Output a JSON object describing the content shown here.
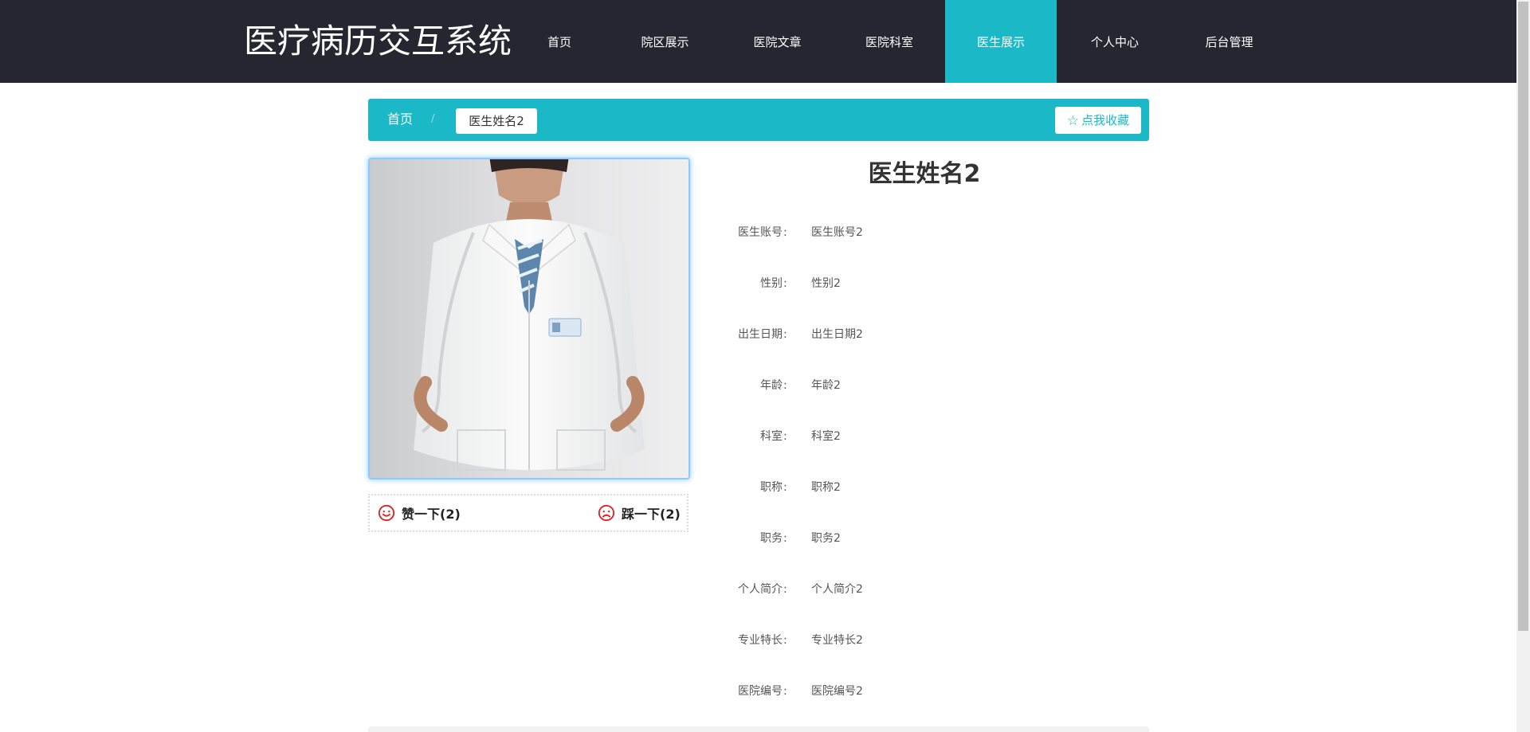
{
  "app": {
    "title": "医疗病历交互系统"
  },
  "nav": {
    "items": [
      {
        "label": "首页"
      },
      {
        "label": "院区展示"
      },
      {
        "label": "医院文章"
      },
      {
        "label": "医院科室"
      },
      {
        "label": "医生展示",
        "active": true
      },
      {
        "label": "个人中心"
      },
      {
        "label": "后台管理"
      }
    ]
  },
  "breadcrumb": {
    "home": "首页",
    "separator": "/",
    "current": "医生姓名2"
  },
  "favorite": {
    "icon": "star-outline-icon",
    "label": "点我收藏"
  },
  "doctor": {
    "name": "医生姓名2",
    "photo_icon": "doctor-photo",
    "fields": [
      {
        "label": "医生账号",
        "colon": ":",
        "value": "医生账号2"
      },
      {
        "label": "性别",
        "colon": ":",
        "value": "性别2"
      },
      {
        "label": "出生日期",
        "colon": ":",
        "value": "出生日期2"
      },
      {
        "label": "年龄",
        "colon": ":",
        "value": "年龄2"
      },
      {
        "label": "科室",
        "colon": ":",
        "value": "科室2"
      },
      {
        "label": "职称",
        "colon": ":",
        "value": "职称2"
      },
      {
        "label": "职务",
        "colon": ":",
        "value": "职务2"
      },
      {
        "label": "个人简介",
        "colon": ":",
        "value": "个人简介2"
      },
      {
        "label": "专业特长",
        "colon": ":",
        "value": "专业特长2"
      },
      {
        "label": "医院编号",
        "colon": ":",
        "value": "医院编号2"
      }
    ]
  },
  "votes": {
    "like": {
      "icon": "smile-icon",
      "label": "赞一下(2)"
    },
    "dislike": {
      "icon": "frown-icon",
      "label": "踩一下(2)"
    }
  },
  "colors": {
    "header_bg": "#262631",
    "accent": "#1bb9c8",
    "vote_icon": "#e02020",
    "photo_border": "#8cc9ff"
  }
}
